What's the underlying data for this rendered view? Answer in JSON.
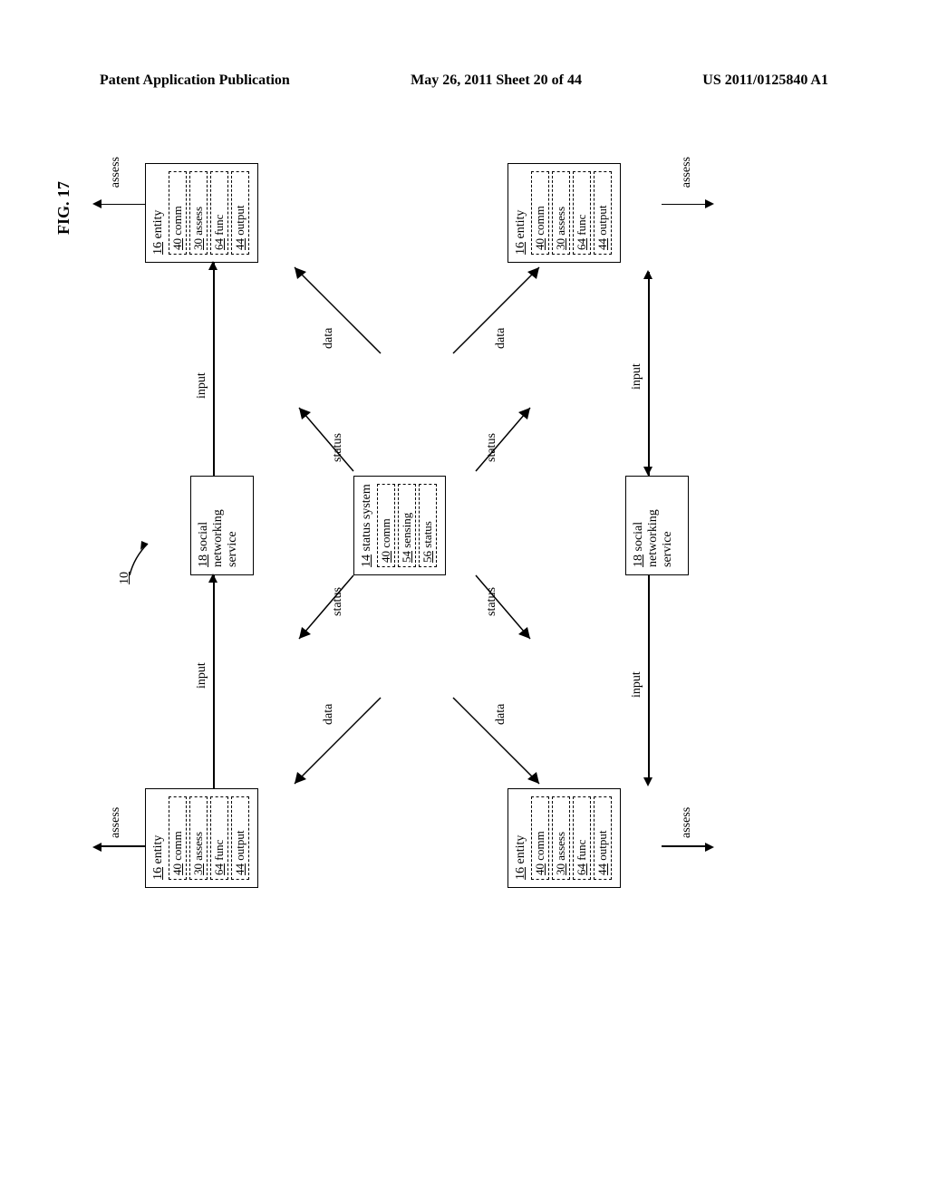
{
  "header": {
    "left": "Patent Application Publication",
    "center": "May 26, 2011  Sheet 20 of 44",
    "right": "US 2011/0125840 A1"
  },
  "figure": {
    "label": "FIG. 17",
    "system_ref": "10"
  },
  "entity": {
    "title_ref": "16",
    "title_label": "entity",
    "comm_ref": "40",
    "comm_label": "comm",
    "assess_ref": "30",
    "assess_label": "assess",
    "func_ref": "64",
    "func_label": "func",
    "output_ref": "44",
    "output_label": "output"
  },
  "service": {
    "ref": "18",
    "label": "social networking service"
  },
  "status_system": {
    "title_ref": "14",
    "title_label": "status system",
    "comm_ref": "40",
    "comm_label": "comm",
    "sensing_ref": "54",
    "sensing_label": "sensing",
    "status_ref": "56",
    "status_label": "status"
  },
  "labels": {
    "assess": "assess",
    "input": "input",
    "data": "data",
    "status": "status"
  }
}
